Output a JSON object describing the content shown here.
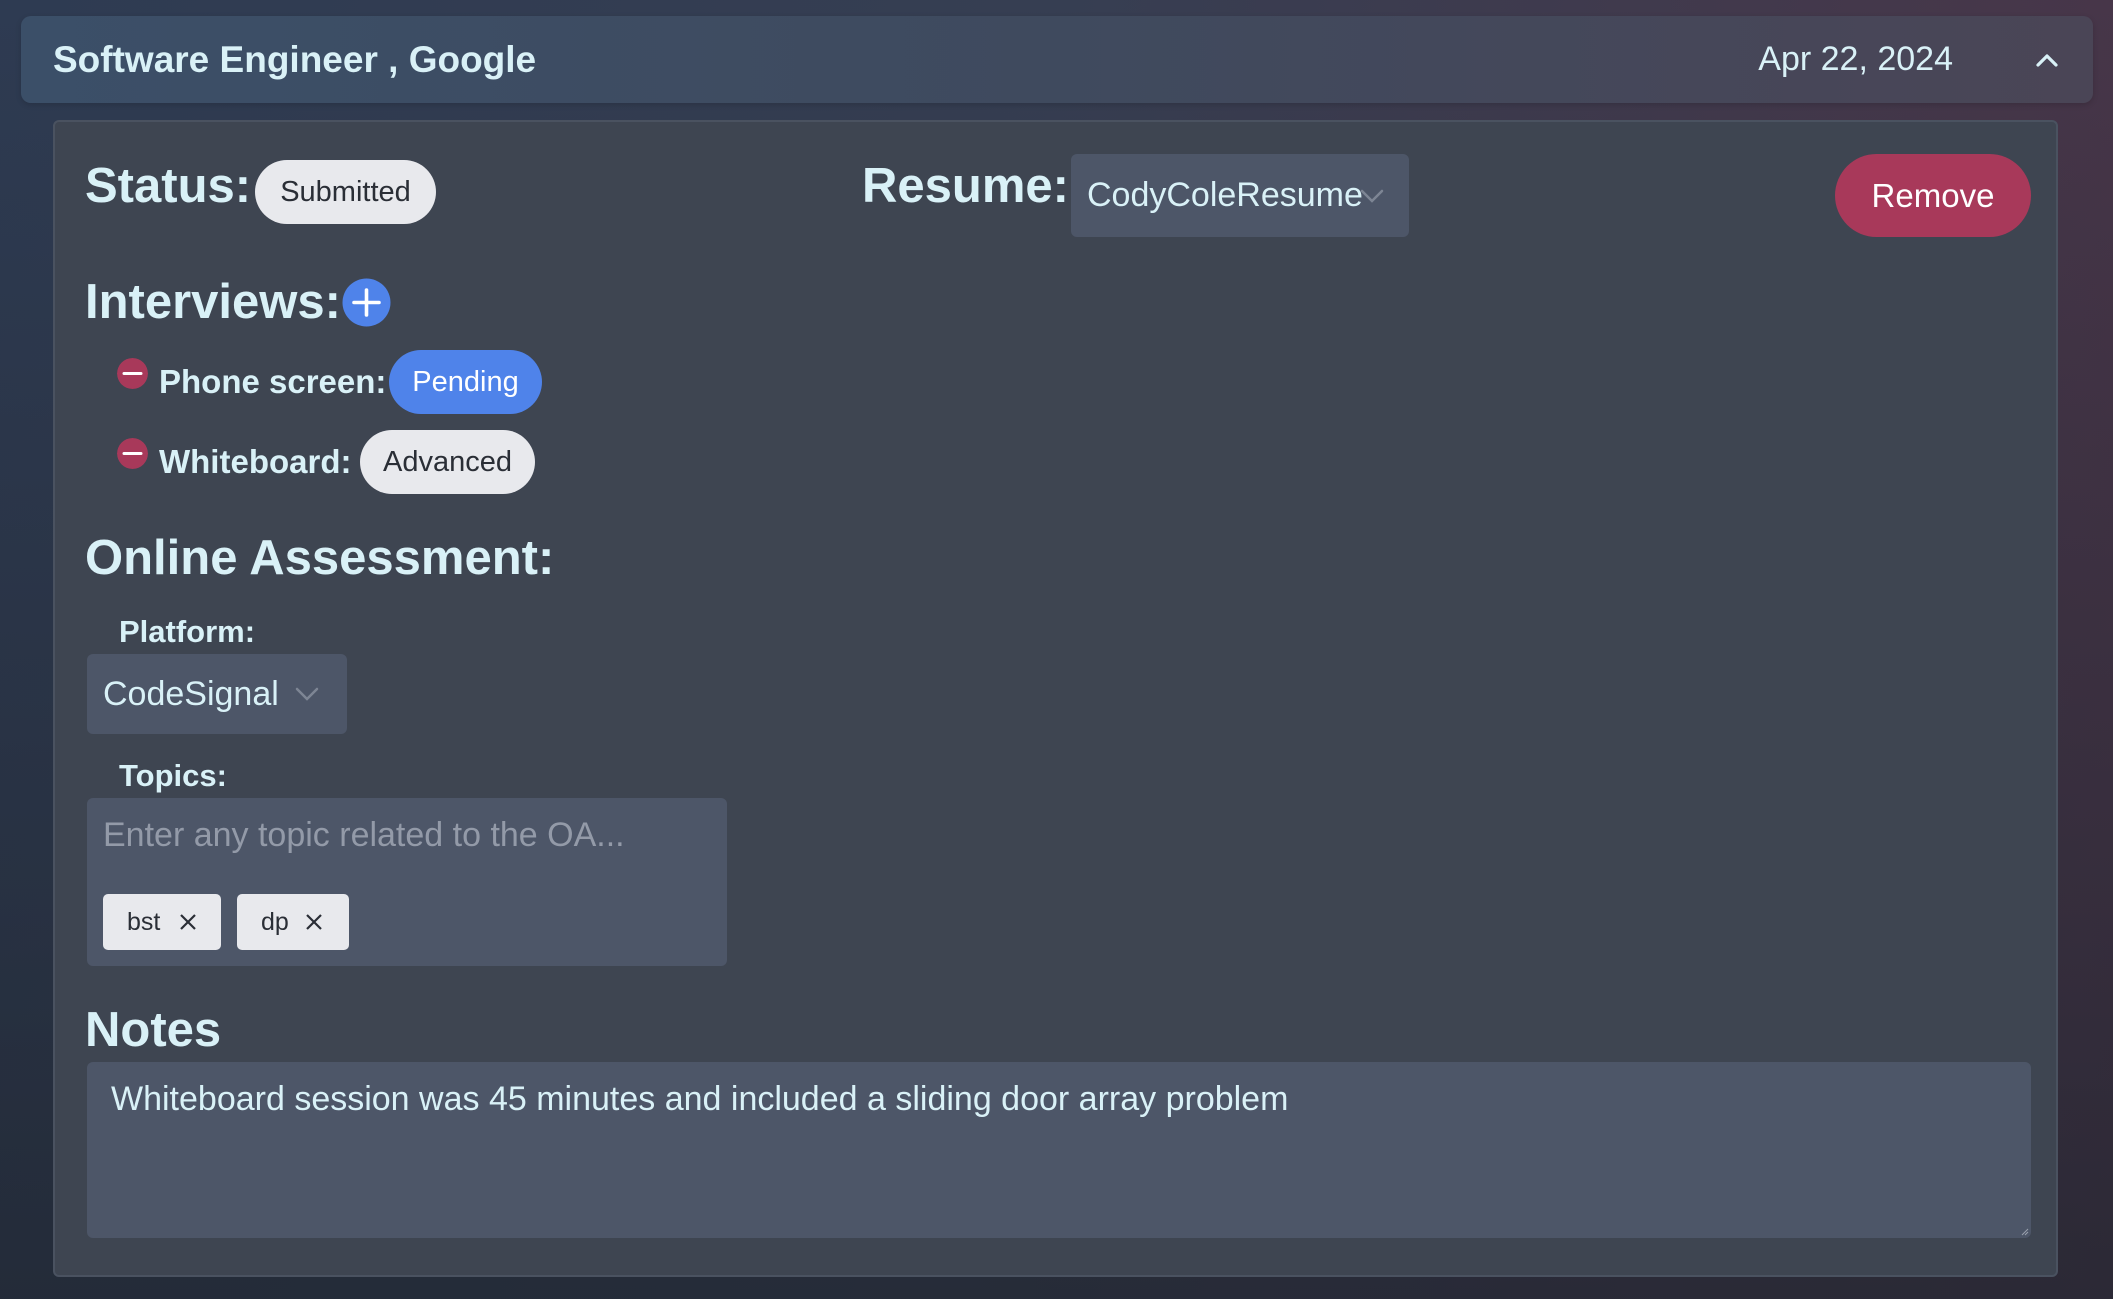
{
  "header": {
    "title": "Software Engineer , Google",
    "date": "Apr 22, 2024",
    "collapse_icon": "chevron-up-icon"
  },
  "status": {
    "label": "Status:",
    "value": "Submitted"
  },
  "resume": {
    "label": "Resume:",
    "selected": "CodyColeResume"
  },
  "remove_button": "Remove",
  "interviews": {
    "label": "Interviews:",
    "add_icon": "plus-circle-icon",
    "items": [
      {
        "name": "Phone screen:",
        "status": "Pending",
        "status_style": "blue"
      },
      {
        "name": "Whiteboard:",
        "status": "Advanced",
        "status_style": "light"
      }
    ]
  },
  "online_assessment": {
    "label": "Online Assessment:",
    "platform_label": "Platform:",
    "platform_selected": "CodeSignal",
    "topics_label": "Topics:",
    "topics_placeholder": "Enter any topic related to the OA...",
    "topics": [
      "bst",
      "dp"
    ]
  },
  "notes": {
    "label": "Notes",
    "value": "Whiteboard session was 45 minutes and included a sliding door array problem"
  },
  "colors": {
    "accent_blue": "#4f83ea",
    "danger": "#a8395a",
    "heading_text": "#d9f1f7"
  }
}
